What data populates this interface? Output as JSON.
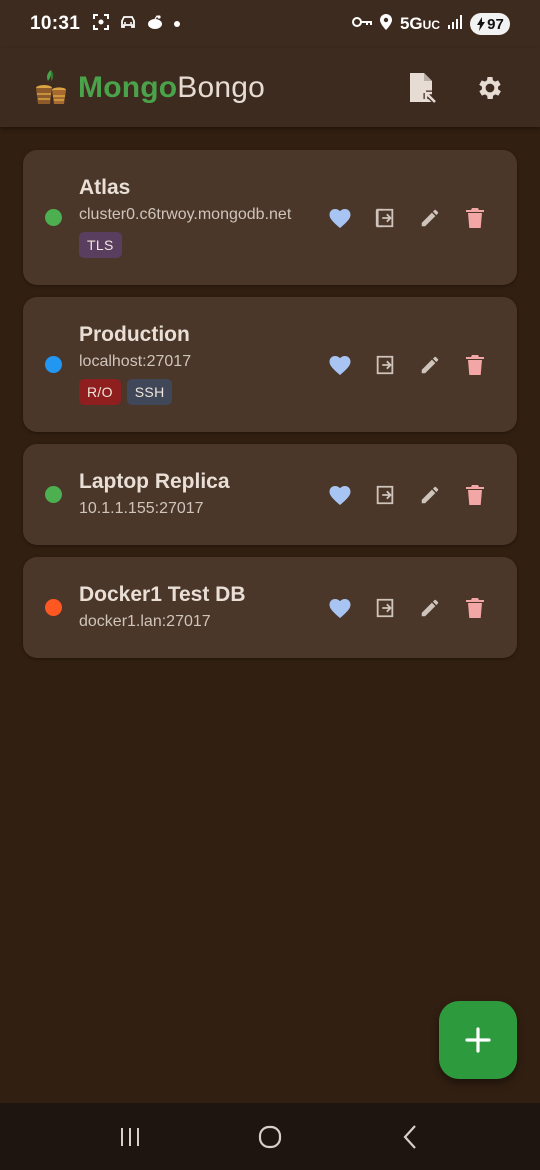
{
  "status_bar": {
    "time": "10:31",
    "network": "5G",
    "network_sub": "UC",
    "battery": "97"
  },
  "app": {
    "title_part1": "Mongo",
    "title_part2": "Bongo",
    "icons": {
      "import": "file-import-icon",
      "settings": "gear-icon"
    }
  },
  "connections": [
    {
      "name": "Atlas",
      "host": "cluster0.c6trwoy.mongodb.net",
      "status_color": "#4caf50",
      "tags": [
        {
          "label": "TLS",
          "color": "#5a3e60"
        }
      ]
    },
    {
      "name": "Production",
      "host": "localhost:27017",
      "status_color": "#2196f3",
      "tags": [
        {
          "label": "R/O",
          "color": "#8f1e1e"
        },
        {
          "label": "SSH",
          "color": "#3f4759"
        }
      ]
    },
    {
      "name": "Laptop Replica",
      "host": "10.1.1.155:27017",
      "status_color": "#4caf50",
      "tags": []
    },
    {
      "name": "Docker1 Test DB",
      "host": "docker1.lan:27017",
      "status_color": "#ff5722",
      "tags": []
    }
  ],
  "colors": {
    "favorite": "#a8c4f2",
    "action": "#cfc4bb",
    "delete": "#f2a6a6",
    "fab": "#2e9a3e",
    "brand_green": "#4aa34a"
  },
  "fab_icon": "plus-icon",
  "nav_icons": [
    "recent-apps-icon",
    "home-icon",
    "back-icon"
  ]
}
